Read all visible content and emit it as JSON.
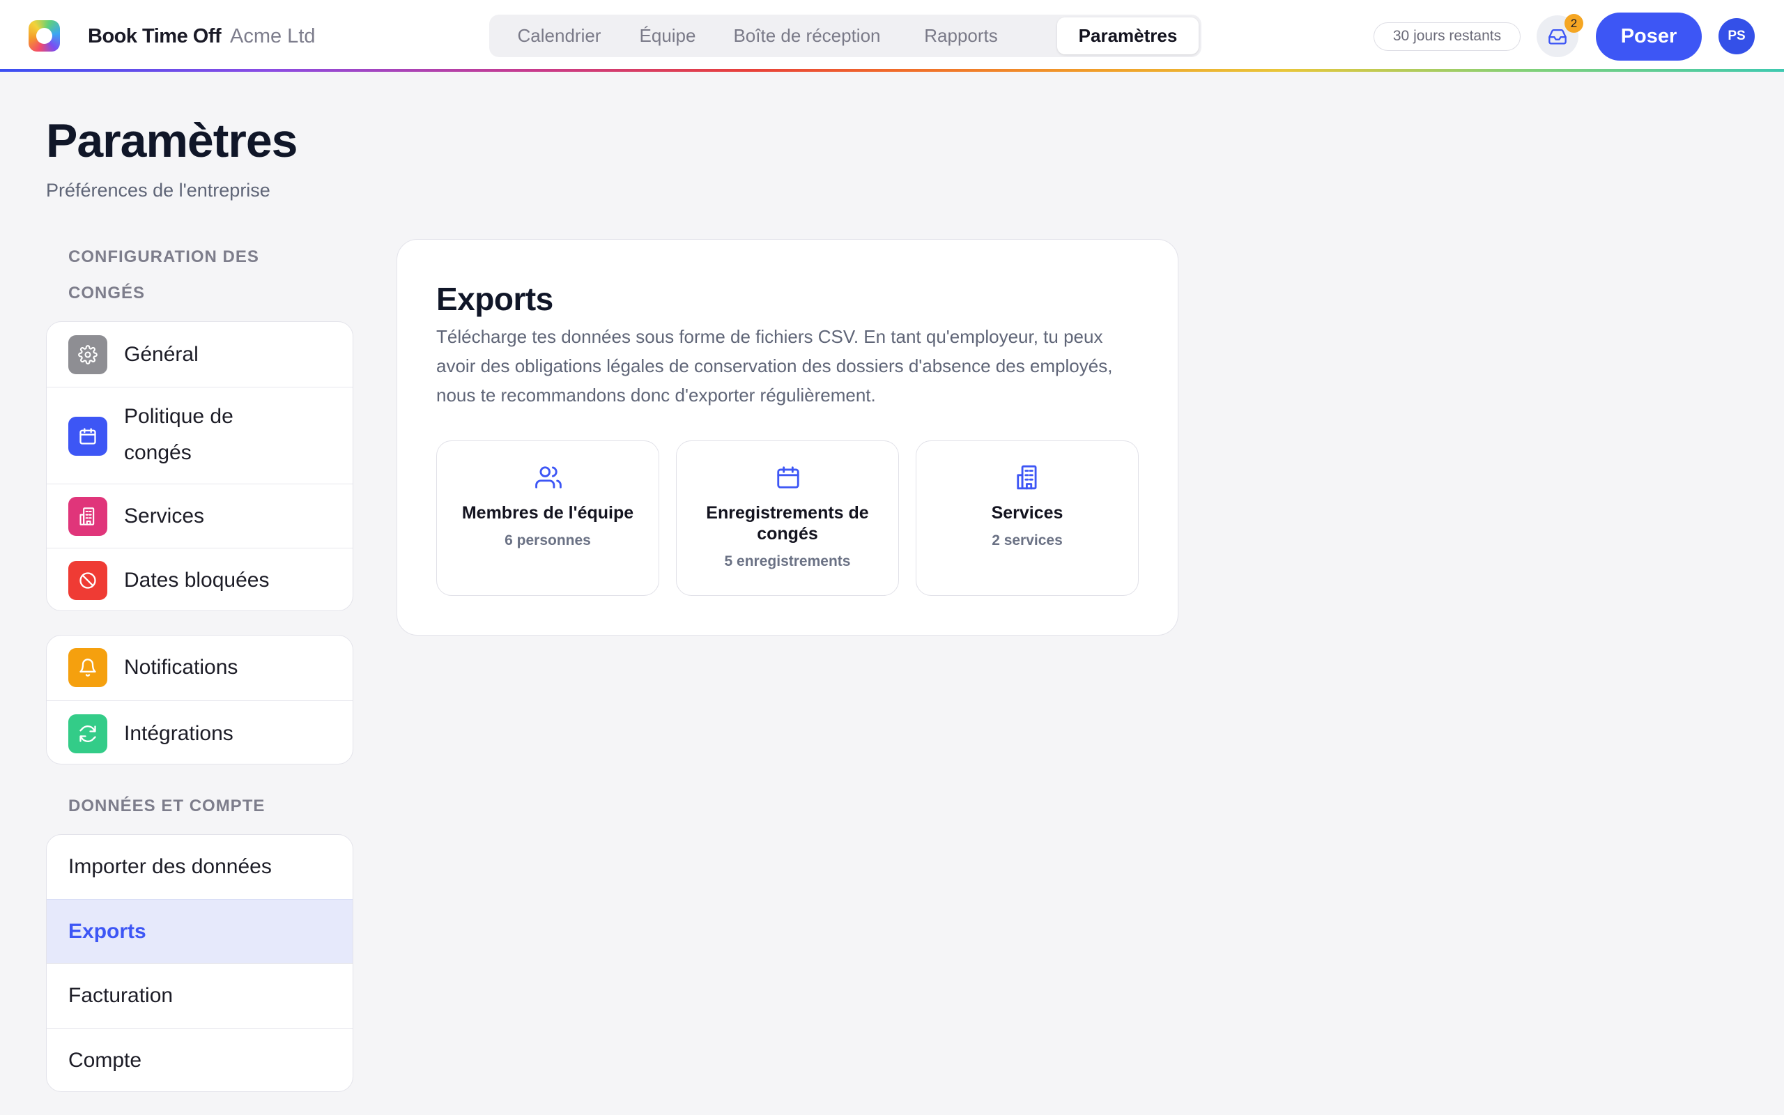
{
  "header": {
    "app_name": "Book Time Off",
    "company": "Acme Ltd",
    "tabs": [
      {
        "label": "Calendrier",
        "active": false
      },
      {
        "label": "Équipe",
        "active": false
      },
      {
        "label": "Boîte de réception",
        "active": false
      },
      {
        "label": "Rapports",
        "active": false
      },
      {
        "label": "Paramètres",
        "active": true
      }
    ],
    "days_remaining": "30 jours restants",
    "inbox_count": "2",
    "request_button": "Poser",
    "avatar_initials": "PS"
  },
  "page": {
    "title": "Paramètres",
    "subtitle": "Préférences de l'entreprise"
  },
  "sidebar": {
    "section_leave_line1": "CONFIGURATION DES",
    "section_leave_line2": "CONGÉS",
    "leave_items": [
      {
        "label": "Général",
        "icon": "gear-icon",
        "color": "#8e8e93"
      },
      {
        "label_line1": "Politique de",
        "label_line2": "congés",
        "icon": "calendar-icon",
        "color": "#3d56f5"
      },
      {
        "label": "Services",
        "icon": "building-icon",
        "color": "#e0357a"
      },
      {
        "label": "Dates bloquées",
        "icon": "block-icon",
        "color": "#ef3b34"
      }
    ],
    "tools_items": [
      {
        "label": "Notifications",
        "icon": "bell-icon",
        "color": "#f5a00e"
      },
      {
        "label": "Intégrations",
        "icon": "sync-icon",
        "color": "#33cc88"
      }
    ],
    "section_data": "DONNÉES ET COMPTE",
    "data_items": [
      {
        "label": "Importer des données",
        "selected": false
      },
      {
        "label": "Exports",
        "selected": true
      },
      {
        "label": "Facturation",
        "selected": false
      },
      {
        "label": "Compte",
        "selected": false
      }
    ]
  },
  "exports": {
    "title": "Exports",
    "description": "Télécharge tes données sous forme de fichiers CSV. En tant qu'employeur, tu peux avoir des obligations légales de conservation des dossiers d'absence des employés, nous te recommandons donc d'exporter régulièrement.",
    "tiles": [
      {
        "title": "Membres de l'équipe",
        "subtitle": "6 personnes",
        "icon": "users-icon"
      },
      {
        "title_line1": "Enregistrements de",
        "title_line2": "congés",
        "subtitle": "5 enregistrements",
        "icon": "calendar-icon"
      },
      {
        "title": "Services",
        "subtitle": "2 services",
        "icon": "building-icon"
      }
    ]
  },
  "colors": {
    "accent": "#3d56f5",
    "badge": "#f5a623",
    "selected_bg": "#e6e9fb"
  }
}
